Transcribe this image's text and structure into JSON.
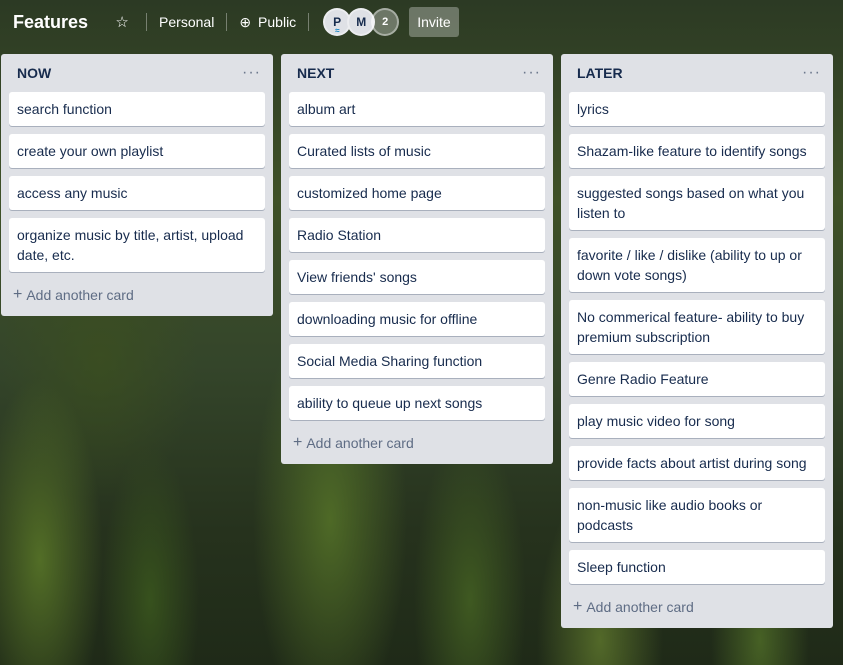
{
  "board": {
    "title": "Features",
    "visibility_team": "Personal",
    "visibility": "Public",
    "invite_label": "Invite",
    "members": [
      {
        "initial": "P"
      },
      {
        "initial": "M"
      }
    ],
    "extra_members_count": "2"
  },
  "lists": [
    {
      "title": "NOW",
      "cards": [
        "search function",
        "create your own playlist",
        "access any music",
        "organize music by title, artist, upload date, etc."
      ],
      "add_label": "Add another card"
    },
    {
      "title": "NEXT",
      "cards": [
        "album art",
        "Curated lists of music",
        "customized home page",
        "Radio Station",
        "View friends' songs",
        "downloading music for offline",
        "Social Media Sharing function",
        "ability to queue up next songs"
      ],
      "add_label": "Add another card"
    },
    {
      "title": "LATER",
      "cards": [
        "lyrics",
        "Shazam-like feature to identify songs",
        "suggested songs based on what you listen to",
        "favorite / like / dislike (ability to up or down vote songs)",
        "No commerical feature- ability to buy premium subscription",
        "Genre Radio Feature",
        "play music video for song",
        "provide facts about artist during song",
        "non-music like audio books or podcasts",
        "Sleep function"
      ],
      "add_label": "Add another card"
    }
  ]
}
